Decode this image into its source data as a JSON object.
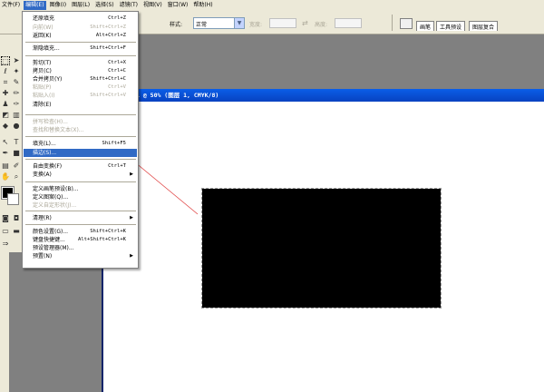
{
  "menubar": {
    "items": [
      {
        "label": "文件(F)"
      },
      {
        "label": "编辑(E)",
        "active": true
      },
      {
        "label": "图像(I)"
      },
      {
        "label": "图层(L)"
      },
      {
        "label": "选择(S)"
      },
      {
        "label": "滤镜(T)"
      },
      {
        "label": "视图(V)"
      },
      {
        "label": "窗口(W)"
      },
      {
        "label": "帮助(H)"
      }
    ]
  },
  "options": {
    "style_label": "样式:",
    "style_value": "正常",
    "width_label": "宽度:",
    "height_label": "高度:",
    "tabs": [
      "画笔",
      "工具预设",
      "图层复合"
    ]
  },
  "document": {
    "title": "1 @ 50% (图层 1, CMYK/8)"
  },
  "edit_menu": {
    "items": [
      {
        "label": "还原填充",
        "shortcut": "Ctrl+Z",
        "disabled": false
      },
      {
        "label": "向前(W)",
        "shortcut": "Shift+Ctrl+Z",
        "disabled": true
      },
      {
        "label": "返回(K)",
        "shortcut": "Alt+Ctrl+Z",
        "disabled": false
      },
      {
        "label": "渐隐填充...",
        "shortcut": "Shift+Ctrl+F",
        "disabled": false
      },
      {
        "label": "剪切(T)",
        "shortcut": "Ctrl+X",
        "disabled": false
      },
      {
        "label": "拷贝(C)",
        "shortcut": "Ctrl+C",
        "disabled": false
      },
      {
        "label": "合并拷贝(Y)",
        "shortcut": "Shift+Ctrl+C",
        "disabled": false
      },
      {
        "label": "粘贴(P)",
        "shortcut": "Ctrl+V",
        "disabled": true
      },
      {
        "label": "粘贴入(I)",
        "shortcut": "Shift+Ctrl+V",
        "disabled": true
      },
      {
        "label": "清除(E)",
        "shortcut": "",
        "disabled": false
      },
      {
        "label": "拼写检查(H)...",
        "shortcut": "",
        "disabled": true
      },
      {
        "label": "查找和替换文本(X)...",
        "shortcut": "",
        "disabled": true
      },
      {
        "label": "填充(L)...",
        "shortcut": "Shift+F5",
        "disabled": false
      },
      {
        "label": "描边(S)...",
        "shortcut": "",
        "disabled": false,
        "highlighted": true
      },
      {
        "label": "自由变换(F)",
        "shortcut": "Ctrl+T",
        "disabled": false
      },
      {
        "label": "变换(A)",
        "shortcut": "",
        "disabled": false,
        "submenu": true
      },
      {
        "label": "定义画笔预设(B)...",
        "shortcut": "",
        "disabled": false
      },
      {
        "label": "定义图案(Q)...",
        "shortcut": "",
        "disabled": false
      },
      {
        "label": "定义自定形状(J)...",
        "shortcut": "",
        "disabled": true
      },
      {
        "label": "清理(R)",
        "shortcut": "",
        "disabled": false,
        "submenu": true
      },
      {
        "label": "颜色设置(G)...",
        "shortcut": "Shift+Ctrl+K",
        "disabled": false
      },
      {
        "label": "键盘快捷键...",
        "shortcut": "Alt+Shift+Ctrl+K",
        "disabled": false
      },
      {
        "label": "预设管理器(M)...",
        "shortcut": "",
        "disabled": false
      },
      {
        "label": "预置(N)",
        "shortcut": "",
        "disabled": false,
        "submenu": true
      }
    ],
    "submenu_glyph": "▶"
  },
  "colors": {
    "menu_highlight": "#316ac5",
    "title_bar": "#0a5ee8",
    "arrow": "#e04040",
    "canvas_fill": "#000000"
  }
}
